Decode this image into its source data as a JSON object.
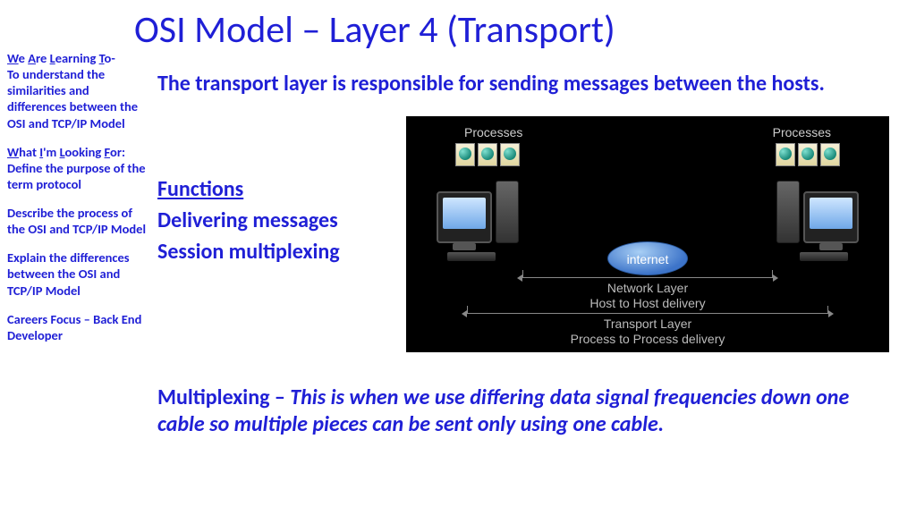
{
  "title": "OSI Model – Layer 4 (Transport)",
  "sidebar": {
    "walt_label_parts": [
      "W",
      "e ",
      "A",
      "re ",
      "L",
      "earning ",
      "T",
      "o-"
    ],
    "walt_text": "To understand the similarities and differences between the OSI and TCP/IP Model",
    "wilf_label_parts": [
      "W",
      "hat ",
      "I",
      "'m ",
      "L",
      "ooking ",
      "F",
      "or:"
    ],
    "wilf_1": "Define the purpose of the term protocol",
    "wilf_2": "Describe the process of the OSI and TCP/IP Model",
    "wilf_3": "Explain the differences between the OSI and TCP/IP Model",
    "careers": "Careers Focus – Back End Developer"
  },
  "intro": "The transport layer is responsible for sending messages between the hosts.",
  "functions": {
    "heading": "Functions",
    "item1": "Delivering messages",
    "item2": "Session multiplexing"
  },
  "multiplex": {
    "term": "Multiplexing – ",
    "definition": "This is when we use differing data signal frequencies down one cable so multiple pieces can be sent only using one cable."
  },
  "diagram": {
    "processes": "Processes",
    "internet": "internet",
    "network_layer": "Network Layer",
    "network_sub": "Host to Host delivery",
    "transport_layer": "Transport Layer",
    "transport_sub": "Process to Process delivery"
  }
}
